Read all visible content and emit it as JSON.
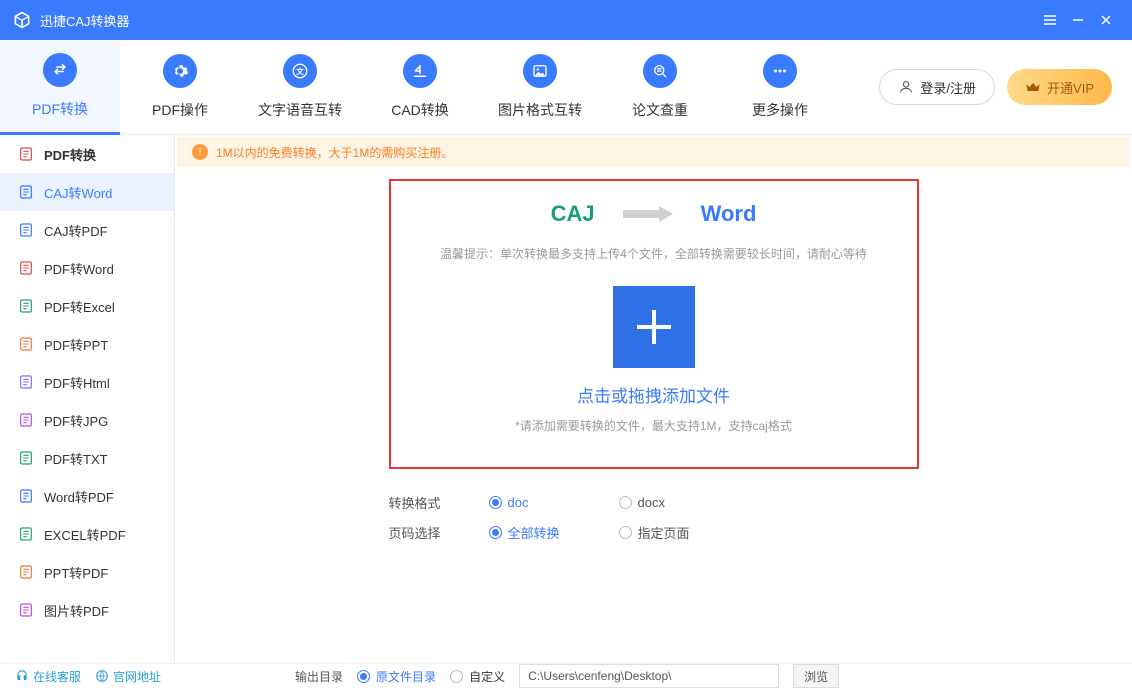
{
  "titlebar": {
    "app_title": "迅捷CAJ转换器"
  },
  "topnav": [
    {
      "label": "PDF转换"
    },
    {
      "label": "PDF操作"
    },
    {
      "label": "文字语音互转"
    },
    {
      "label": "CAD转换"
    },
    {
      "label": "图片格式互转"
    },
    {
      "label": "论文查重"
    },
    {
      "label": "更多操作"
    }
  ],
  "login_label": "登录/注册",
  "vip_label": "开通VIP",
  "sidebar": [
    {
      "label": "PDF转换",
      "color": "#d94b4b",
      "bold": true
    },
    {
      "label": "CAJ转Word",
      "color": "#3a7afe",
      "active": true
    },
    {
      "label": "CAJ转PDF",
      "color": "#3a7afe"
    },
    {
      "label": "PDF转Word",
      "color": "#d94b4b"
    },
    {
      "label": "PDF转Excel",
      "color": "#2aa06a"
    },
    {
      "label": "PDF转PPT",
      "color": "#e67a3c"
    },
    {
      "label": "PDF转Html",
      "color": "#7a6cff"
    },
    {
      "label": "PDF转JPG",
      "color": "#b54eea"
    },
    {
      "label": "PDF转TXT",
      "color": "#2aa06a"
    },
    {
      "label": "Word转PDF",
      "color": "#3a7afe"
    },
    {
      "label": "EXCEL转PDF",
      "color": "#2aa06a"
    },
    {
      "label": "PPT转PDF",
      "color": "#e67a3c"
    },
    {
      "label": "图片转PDF",
      "color": "#b54eea"
    }
  ],
  "notice": "1M以内的免费转换，大于1M的需购买注册。",
  "drop": {
    "from": "CAJ",
    "to": "Word",
    "tip": "温馨提示：单次转换最多支持上传4个文件，全部转换需要较长时间，请耐心等待",
    "drag": "点击或拖拽添加文件",
    "hint": "*请添加需要转换的文件，最大支持1M，支持caj格式"
  },
  "opts": {
    "format_label": "转换格式",
    "format_a": "doc",
    "format_b": "docx",
    "page_label": "页码选择",
    "page_a": "全部转换",
    "page_b": "指定页面"
  },
  "footer": {
    "cs": "在线客服",
    "web": "官网地址",
    "out_label": "输出目录",
    "orig_dir": "原文件目录",
    "custom": "自定义",
    "path": "C:\\Users\\cenfeng\\Desktop\\",
    "browse": "浏览"
  }
}
